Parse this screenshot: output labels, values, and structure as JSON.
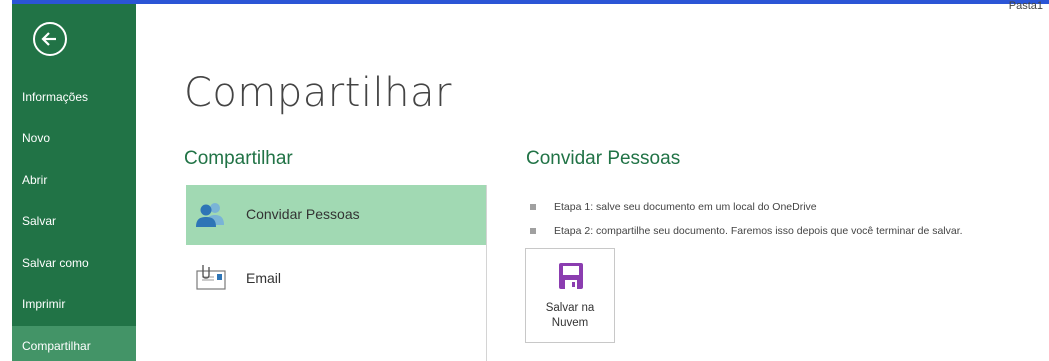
{
  "window": {
    "document_title": "Pasta1"
  },
  "sidebar": {
    "back_icon": "back-arrow-icon",
    "items": [
      {
        "label": "Informações",
        "active": false
      },
      {
        "label": "Novo",
        "active": false
      },
      {
        "label": "Abrir",
        "active": false
      },
      {
        "label": "Salvar",
        "active": false
      },
      {
        "label": "Salvar como",
        "active": false
      },
      {
        "label": "Imprimir",
        "active": false
      },
      {
        "label": "Compartilhar",
        "active": true
      }
    ]
  },
  "main": {
    "title": "Compartilhar",
    "share_section": {
      "title": "Compartilhar",
      "options": [
        {
          "label": "Convidar Pessoas",
          "icon": "people-icon",
          "selected": true
        },
        {
          "label": "Email",
          "icon": "email-icon",
          "selected": false
        }
      ]
    },
    "invite_panel": {
      "title": "Convidar Pessoas",
      "steps": [
        "Etapa 1: salve seu documento em um local do OneDrive",
        "Etapa 2: compartilhe seu documento. Faremos isso depois que você terminar de salvar."
      ],
      "save_button": {
        "line1": "Salvar na",
        "line2": "Nuvem",
        "icon": "save-disk-icon"
      }
    }
  },
  "colors": {
    "sidebar_bg": "#217346",
    "sidebar_active": "#439467",
    "accent_green": "#217346",
    "selected_option": "#a1d9b3",
    "save_icon_purple": "#8b3db0"
  }
}
